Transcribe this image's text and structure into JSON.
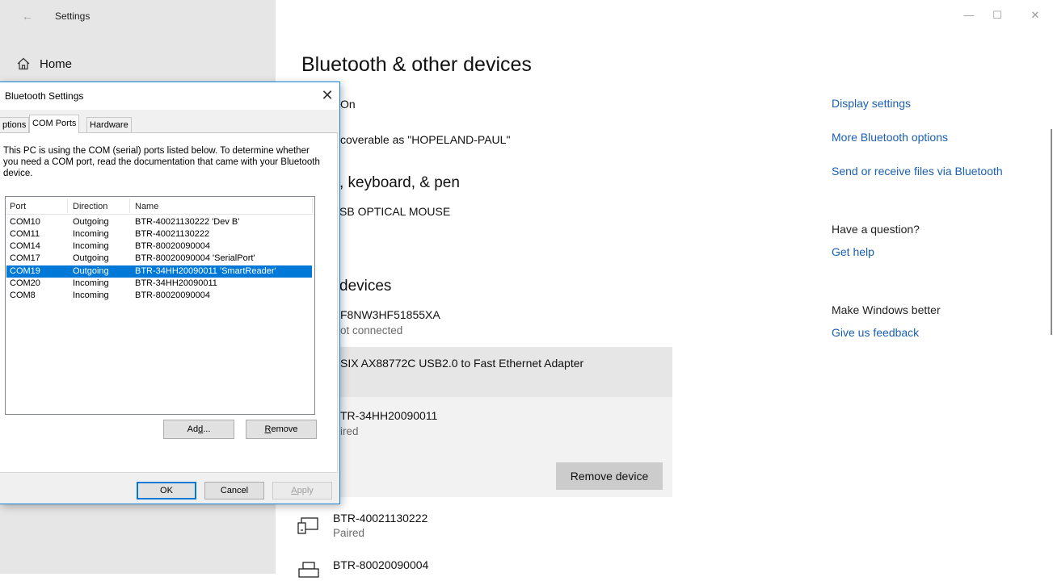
{
  "window": {
    "title": "Settings",
    "back_glyph": "←",
    "minimize_glyph": "—",
    "maximize_glyph": "☐",
    "close_glyph": "✕"
  },
  "nav": {
    "home": "Home"
  },
  "page": {
    "title": "Bluetooth & other devices",
    "bluetooth_state": "On",
    "discoverable": "coverable as \"HOPELAND-PAUL\"",
    "mouse_section": ", keyboard, & pen",
    "mouse_device": "SB OPTICAL MOUSE",
    "other_section": "devices",
    "devices": [
      {
        "name": "F8NW3HF51855XA",
        "status": "ot connected"
      },
      {
        "name": "SIX AX88772C USB2.0 to Fast Ethernet Adapter"
      },
      {
        "name": "TR-34HH20090011",
        "status": "ired"
      },
      {
        "name": "BTR-40021130222",
        "status": "Paired"
      },
      {
        "name": "BTR-80020090004"
      }
    ],
    "remove_device_label": "Remove device"
  },
  "related": {
    "links": [
      "Display settings",
      "More Bluetooth options",
      "Send or receive files via Bluetooth"
    ],
    "question_heading": "Have a question?",
    "get_help": "Get help",
    "better_heading": "Make Windows better",
    "feedback": "Give us feedback"
  },
  "dialog": {
    "title": "Bluetooth Settings",
    "close_glyph": "✕",
    "tabs": [
      "ptions",
      "COM Ports",
      "Hardware"
    ],
    "active_tab": "COM Ports",
    "description": "This PC is using the COM (serial) ports listed below. To determine whether you need a COM port, read the documentation that came with your Bluetooth device.",
    "columns": [
      "Port",
      "Direction",
      "Name"
    ],
    "rows": [
      {
        "port": "COM10",
        "direction": "Outgoing",
        "name": "BTR-40021130222 'Dev B'"
      },
      {
        "port": "COM11",
        "direction": "Incoming",
        "name": "BTR-40021130222"
      },
      {
        "port": "COM14",
        "direction": "Incoming",
        "name": "BTR-80020090004"
      },
      {
        "port": "COM17",
        "direction": "Outgoing",
        "name": "BTR-80020090004 'SerialPort'"
      },
      {
        "port": "COM19",
        "direction": "Outgoing",
        "name": "BTR-34HH20090011 'SmartReader'"
      },
      {
        "port": "COM20",
        "direction": "Incoming",
        "name": "BTR-34HH20090011"
      },
      {
        "port": "COM8",
        "direction": "Incoming",
        "name": "BTR-80020090004"
      }
    ],
    "selected_port": "COM19",
    "add_label_pre": "Ad",
    "add_label_u": "d",
    "add_label_post": "...",
    "remove_label_u": "R",
    "remove_label_post": "emove",
    "ok_label": "OK",
    "cancel_label": "Cancel",
    "apply_label_u": "A",
    "apply_label_post": "pply"
  },
  "colors": {
    "accent": "#0078d7",
    "link": "#1a5fb4",
    "nav_bg": "#e6e6e6"
  }
}
